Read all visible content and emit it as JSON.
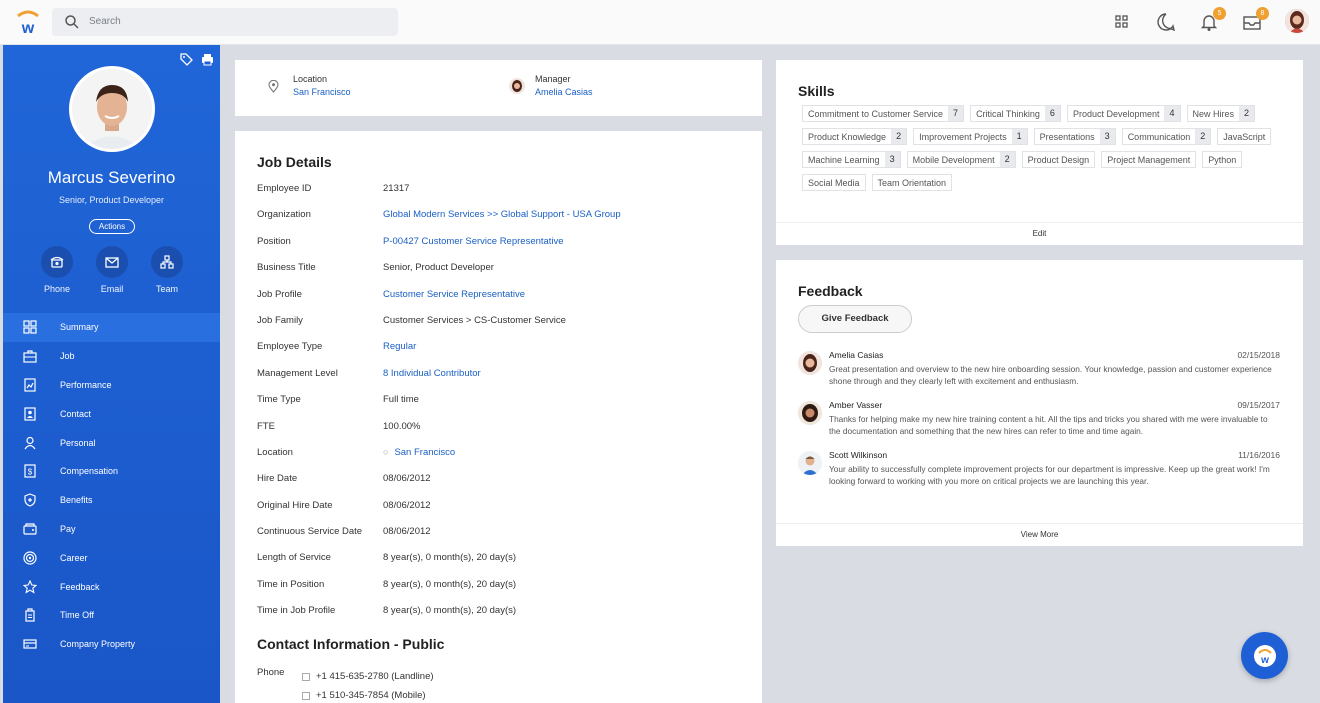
{
  "search": {
    "placeholder": "Search"
  },
  "topbar": {
    "notif_count": "5",
    "inbox_count": "8"
  },
  "profile": {
    "name": "Marcus Severino",
    "title": "Senior, Product Developer",
    "actions_label": "Actions",
    "quick": [
      {
        "label": "Phone",
        "icon": "phone-icon"
      },
      {
        "label": "Email",
        "icon": "email-icon"
      },
      {
        "label": "Team",
        "icon": "team-icon"
      }
    ]
  },
  "nav": [
    {
      "label": "Summary",
      "icon": "summary-icon",
      "active": true
    },
    {
      "label": "Job",
      "icon": "job-icon"
    },
    {
      "label": "Performance",
      "icon": "performance-icon"
    },
    {
      "label": "Contact",
      "icon": "contact-icon"
    },
    {
      "label": "Personal",
      "icon": "personal-icon"
    },
    {
      "label": "Compensation",
      "icon": "compensation-icon"
    },
    {
      "label": "Benefits",
      "icon": "benefits-icon"
    },
    {
      "label": "Pay",
      "icon": "pay-icon"
    },
    {
      "label": "Career",
      "icon": "career-icon"
    },
    {
      "label": "Feedback",
      "icon": "feedback-icon"
    },
    {
      "label": "Time Off",
      "icon": "time-off-icon"
    },
    {
      "label": "Company Property",
      "icon": "company-property-icon"
    }
  ],
  "header_info": {
    "location_label": "Location",
    "location_value": "San Francisco",
    "manager_label": "Manager",
    "manager_value": "Amelia Casias"
  },
  "job_details": {
    "title": "Job Details",
    "rows": [
      {
        "k": "Employee ID",
        "v": "21317",
        "link": false
      },
      {
        "k": "Organization",
        "v": "Global Modern Services >> Global Support - USA Group",
        "link": true
      },
      {
        "k": "Position",
        "v": "P-00427 Customer Service Representative",
        "link": true
      },
      {
        "k": "Business Title",
        "v": "Senior, Product Developer",
        "link": false
      },
      {
        "k": "Job Profile",
        "v": "Customer Service Representative",
        "link": true
      },
      {
        "k": "Job Family",
        "v": "Customer Services > CS-Customer Service",
        "link": false
      },
      {
        "k": "Employee Type",
        "v": "Regular",
        "link": true
      },
      {
        "k": "Management Level",
        "v": "8 Individual Contributor",
        "link": true
      },
      {
        "k": "Time Type",
        "v": "Full time",
        "link": false
      },
      {
        "k": "FTE",
        "v": "100.00%",
        "link": false
      },
      {
        "k": "Location",
        "v": "San Francisco",
        "link": true
      },
      {
        "k": "Hire Date",
        "v": "08/06/2012",
        "link": false
      },
      {
        "k": "Original Hire Date",
        "v": "08/06/2012",
        "link": false
      },
      {
        "k": "Continuous Service Date",
        "v": "08/06/2012",
        "link": false
      },
      {
        "k": "Length of Service",
        "v": "8 year(s), 0 month(s), 20 day(s)",
        "link": false
      },
      {
        "k": "Time in Position",
        "v": "8 year(s), 0 month(s), 20 day(s)",
        "link": false
      },
      {
        "k": "Time in Job Profile",
        "v": "8 year(s), 0 month(s), 20 day(s)",
        "link": false
      }
    ]
  },
  "contact": {
    "title": "Contact Information - Public",
    "phone_label": "Phone",
    "phones": [
      "+1 415-635-2780 (Landline)",
      "+1 510-345-7854 (Mobile)"
    ]
  },
  "skills": {
    "title": "Skills",
    "edit_label": "Edit",
    "tags": [
      {
        "name": "Commitment to Customer Service",
        "count": "7"
      },
      {
        "name": "Critical Thinking",
        "count": "6"
      },
      {
        "name": "Product Development",
        "count": "4"
      },
      {
        "name": "New Hires",
        "count": "2"
      },
      {
        "name": "Product Knowledge",
        "count": "2"
      },
      {
        "name": "Improvement Projects",
        "count": "1"
      },
      {
        "name": "Presentations",
        "count": "3"
      },
      {
        "name": "Communication",
        "count": "2"
      },
      {
        "name": "JavaScript",
        "count": ""
      },
      {
        "name": "Machine Learning",
        "count": "3"
      },
      {
        "name": "Mobile Development",
        "count": "2"
      },
      {
        "name": "Product Design",
        "count": ""
      },
      {
        "name": "Project Management",
        "count": ""
      },
      {
        "name": "Python",
        "count": ""
      },
      {
        "name": "Social Media",
        "count": ""
      },
      {
        "name": "Team Orientation",
        "count": ""
      }
    ]
  },
  "feedback": {
    "title": "Feedback",
    "give_label": "Give Feedback",
    "view_more": "View More",
    "items": [
      {
        "name": "Amelia Casias",
        "date": "02/15/2018",
        "text": "Great presentation and overview to the new hire onboarding session. Your knowledge, passion and customer experience shone through and they clearly left with excitement and enthusiasm."
      },
      {
        "name": "Amber Vasser",
        "date": "09/15/2017",
        "text": "Thanks for helping make my new hire training content a hit. All the tips and tricks you shared with me were invaluable to the documentation and something that the new hires can refer to time and time again."
      },
      {
        "name": "Scott Wilkinson",
        "date": "11/16/2016",
        "text": "Your ability to successfully complete improvement projects for our department is impressive. Keep up the great work! I'm looking forward to working with you more on critical projects we are launching this year."
      }
    ]
  },
  "colors": {
    "brand": "#1f5fd6",
    "link": "#1a5fc4",
    "accent_badge": "#f0a030"
  }
}
